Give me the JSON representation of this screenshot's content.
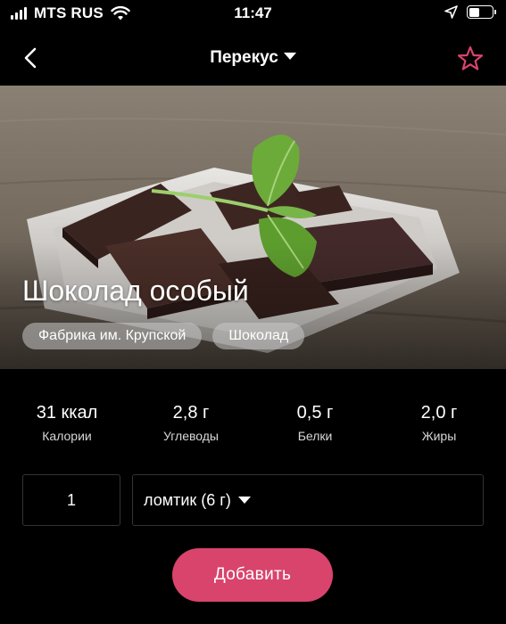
{
  "status_bar": {
    "carrier": "MTS RUS",
    "time": "11:47",
    "battery_level": 0.45
  },
  "nav": {
    "title": "Перекус",
    "back_icon": "chevron-left-icon",
    "favorite_icon": "star-outline-icon",
    "accent_color": "#d8446c"
  },
  "food": {
    "name": "Шоколад особый",
    "tags": [
      "Фабрика им. Крупской",
      "Шоколад"
    ]
  },
  "nutrition": [
    {
      "value": "31 ккал",
      "label": "Калории"
    },
    {
      "value": "2,8 г",
      "label": "Углеводы"
    },
    {
      "value": "0,5 г",
      "label": "Белки"
    },
    {
      "value": "2,0 г",
      "label": "Жиры"
    }
  ],
  "portion": {
    "quantity": "1",
    "unit": "ломтик (6 г)"
  },
  "actions": {
    "add_label": "Добавить",
    "add_color": "#d8446c"
  }
}
